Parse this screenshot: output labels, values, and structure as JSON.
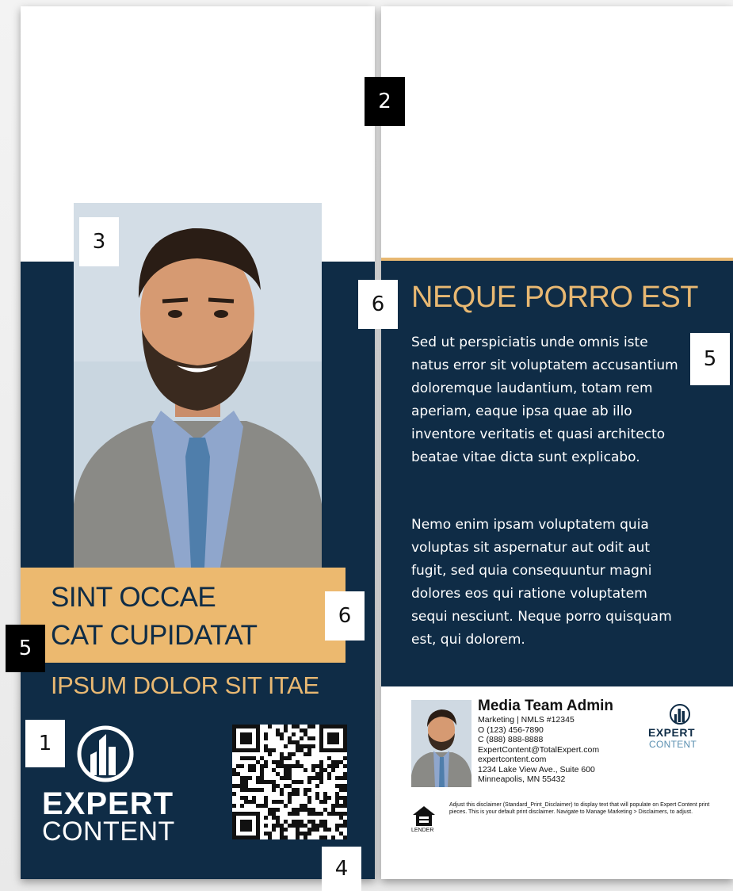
{
  "left_panel": {
    "title_line1": "SINT OCCAE",
    "title_line2": "CAT CUPIDATAT",
    "subtitle": "IPSUM DOLOR SIT ITAE",
    "logo": {
      "word1": "EXPERT",
      "word2": "CONTENT"
    }
  },
  "right_panel": {
    "heading": "NEQUE PORRO EST",
    "paragraph1": "Sed ut perspiciatis unde omnis iste natus error sit voluptatem accusantium doloremque laudantium, totam rem aperiam, eaque ipsa quae ab illo inventore veritatis et quasi architecto beatae vitae dicta sunt explicabo.",
    "paragraph2": "Nemo enim ipsam voluptatem quia voluptas sit aspernatur aut odit aut fugit, sed quia consequuntur magni dolores eos qui ratione voluptatem sequi nesciunt. Neque porro quisquam est, qui dolorem.",
    "contact": {
      "name": "Media Team Admin",
      "line1": "Marketing | NMLS #12345",
      "line2": "O (123) 456-7890",
      "line3": "C (888) 888-8888",
      "line4": "ExpertContent@TotalExpert.com",
      "line5": "expertcontent.com",
      "line6": "1234 Lake View Ave., Suite 600",
      "line7": "Minneapolis, MN 55432"
    },
    "small_logo": {
      "word1": "EXPERT",
      "word2": "CONTENT"
    },
    "housing_label": "LENDER",
    "disclaimer": "Adjust this disclaimer (Standard_Print_Disclaimer) to display text that will populate on Expert Content print pieces. This is your default print disclaimer. Navigate to Manage Marketing > Disclaimers, to adjust."
  },
  "markers": {
    "m1": "1",
    "m2": "2",
    "m3": "3",
    "m4": "4",
    "m5_left": "5",
    "m5_right": "5",
    "m6_left": "6",
    "m6_right": "6"
  },
  "colors": {
    "navy": "#0f2c46",
    "gold": "#e8b872",
    "gold_band": "#ecb96f"
  },
  "icons": [
    "expert-content-logo-icon",
    "qr-code-icon",
    "equal-housing-lender-icon"
  ]
}
